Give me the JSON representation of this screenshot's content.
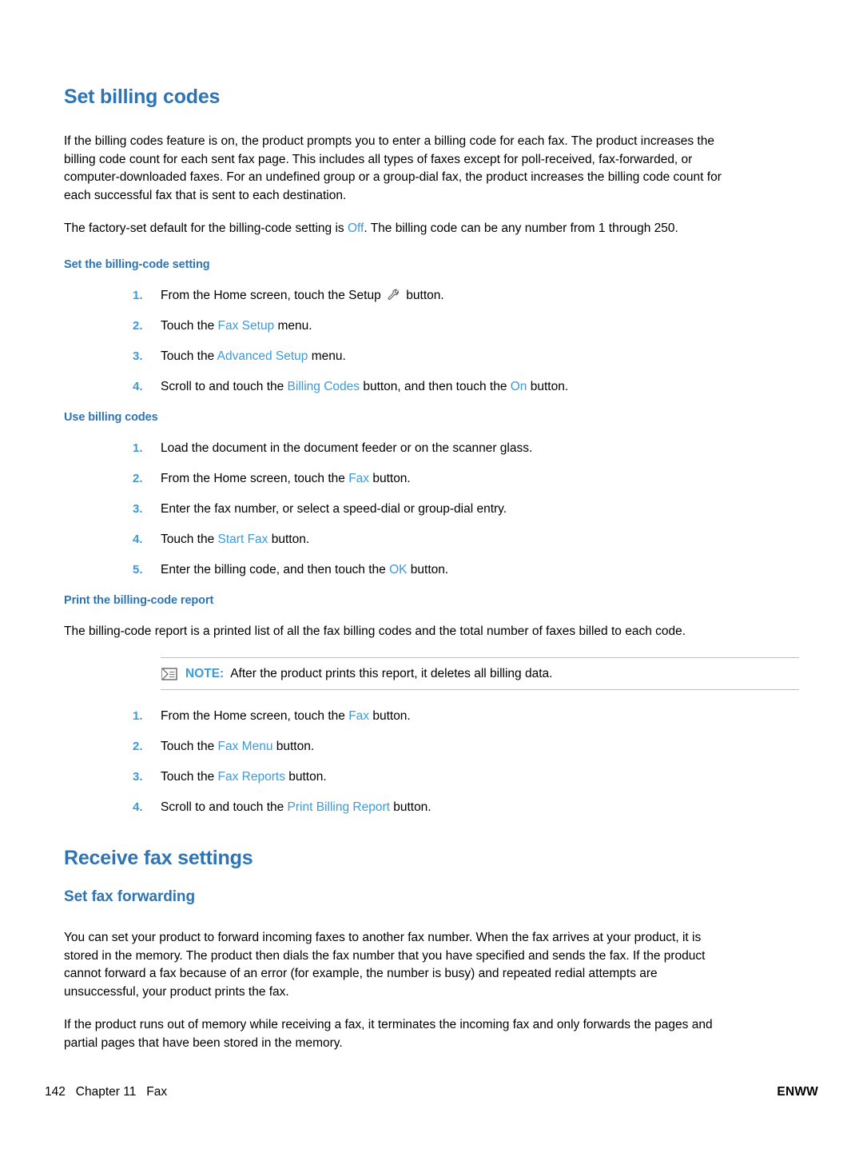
{
  "page": {
    "section1_title": "Set billing codes",
    "para1": "If the billing codes feature is on, the product prompts you to enter a billing code for each fax. The product increases the billing code count for each sent fax page. This includes all types of faxes except for poll-received, fax-forwarded, or computer-downloaded faxes. For an undefined group or a group-dial fax, the product increases the billing code count for each successful fax that is sent to each destination.",
    "para2_a": "The factory-set default for the billing-code setting is ",
    "para2_term": "Off",
    "para2_b": ". The billing code can be any number from 1 through 250.",
    "sub1_title": "Set the billing-code setting",
    "sub1_steps": [
      {
        "num": "1.",
        "pre": "From the Home screen, touch the Setup ",
        "icon": "wrench-icon",
        "post": " button."
      },
      {
        "num": "2.",
        "pre": "Touch the ",
        "term": "Fax Setup",
        "post": " menu."
      },
      {
        "num": "3.",
        "pre": "Touch the ",
        "term": "Advanced Setup",
        "post": " menu."
      },
      {
        "num": "4.",
        "pre": "Scroll to and touch the ",
        "term": "Billing Codes",
        "mid": " button, and then touch the ",
        "term2": "On",
        "post": " button."
      }
    ],
    "sub2_title": "Use billing codes",
    "sub2_steps": [
      {
        "num": "1.",
        "pre": "Load the document in the document feeder or on the scanner glass.",
        "term": "",
        "post": ""
      },
      {
        "num": "2.",
        "pre": "From the Home screen, touch the ",
        "term": "Fax",
        "post": " button."
      },
      {
        "num": "3.",
        "pre": "Enter the fax number, or select a speed-dial or group-dial entry.",
        "term": "",
        "post": ""
      },
      {
        "num": "4.",
        "pre": "Touch the ",
        "term": "Start Fax",
        "post": " button."
      },
      {
        "num": "5.",
        "pre": "Enter the billing code, and then touch the ",
        "term": "OK",
        "post": " button."
      }
    ],
    "sub3_title": "Print the billing-code report",
    "para3": "The billing-code report is a printed list of all the fax billing codes and the total number of faxes billed to each code.",
    "note_label": "NOTE:",
    "note_text": "After the product prints this report, it deletes all billing data.",
    "sub3_steps": [
      {
        "num": "1.",
        "pre": "From the Home screen, touch the ",
        "term": "Fax",
        "post": " button."
      },
      {
        "num": "2.",
        "pre": "Touch the ",
        "term": "Fax Menu",
        "post": " button."
      },
      {
        "num": "3.",
        "pre": "Touch the ",
        "term": "Fax Reports",
        "post": " button."
      },
      {
        "num": "4.",
        "pre": "Scroll to and touch the ",
        "term": "Print Billing Report",
        "post": " button."
      }
    ],
    "section2_title": "Receive fax settings",
    "sub4_title": "Set fax forwarding",
    "para4": "You can set your product to forward incoming faxes to another fax number. When the fax arrives at your product, it is stored in the memory. The product then dials the fax number that you have specified and sends the fax. If the product cannot forward a fax because of an error (for example, the number is busy) and repeated redial attempts are unsuccessful, your product prints the fax.",
    "para5": "If the product runs out of memory while receiving a fax, it terminates the incoming fax and only forwards the pages and partial pages that have been stored in the memory.",
    "footer_left": "142   Chapter 11   Fax",
    "footer_right": "ENWW"
  },
  "colors": {
    "heading_blue": "#2e74b5",
    "ui_term_blue": "#3b9ad9",
    "rule_gray": "#bfbfbf"
  }
}
